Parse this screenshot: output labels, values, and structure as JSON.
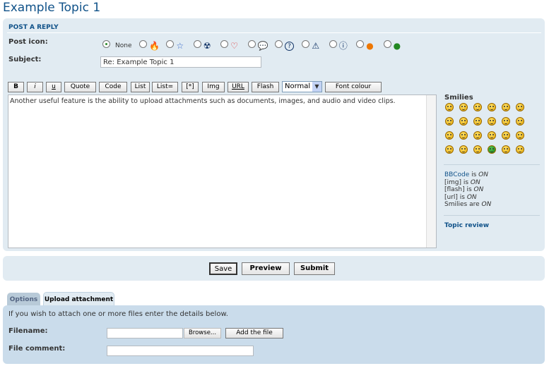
{
  "title": "Example Topic 1",
  "post_panel": {
    "heading": "POST A REPLY",
    "post_icon_label": "Post icon:",
    "none_label": "None",
    "post_icons": [
      "fire-icon",
      "star-icon",
      "radioactive-icon",
      "heart-icon",
      "speech-bubble-icon",
      "question-icon",
      "warning-icon",
      "info-icon",
      "mad-face-icon",
      "grin-green-icon"
    ],
    "subject_label": "Subject:",
    "subject_value": "Re: Example Topic 1"
  },
  "toolbar": {
    "buttons": [
      "B",
      "i",
      "u",
      "Quote",
      "Code",
      "List",
      "List=",
      "[*]",
      "Img",
      "URL",
      "Flash"
    ],
    "size_value": "Normal",
    "font_colour": "Font colour"
  },
  "message": "Another useful feature is the ability to upload attachments such as documents, images, and audio and video clips.",
  "sidebar": {
    "smilies_title": "Smilies",
    "bbcode_link": "BBCode",
    "bbcode_rest": " is ",
    "on": "ON",
    "img": "[img] is ",
    "flash": "[flash] is ",
    "url": "[url] is ",
    "smilies": "Smilies are ",
    "topic_review": "Topic review"
  },
  "actions": {
    "save": "Save",
    "preview": "Preview",
    "submit": "Submit"
  },
  "tabs": {
    "options": "Options",
    "upload": "Upload attachment"
  },
  "upload": {
    "intro": "If you wish to attach one or more files enter the details below.",
    "filename_label": "Filename:",
    "browse": "Browse...",
    "add_file": "Add the file",
    "comment_label": "File comment:"
  },
  "colors": {
    "title": "#105289",
    "panel": "#e1ebf2",
    "upload_panel": "#cadceb"
  }
}
